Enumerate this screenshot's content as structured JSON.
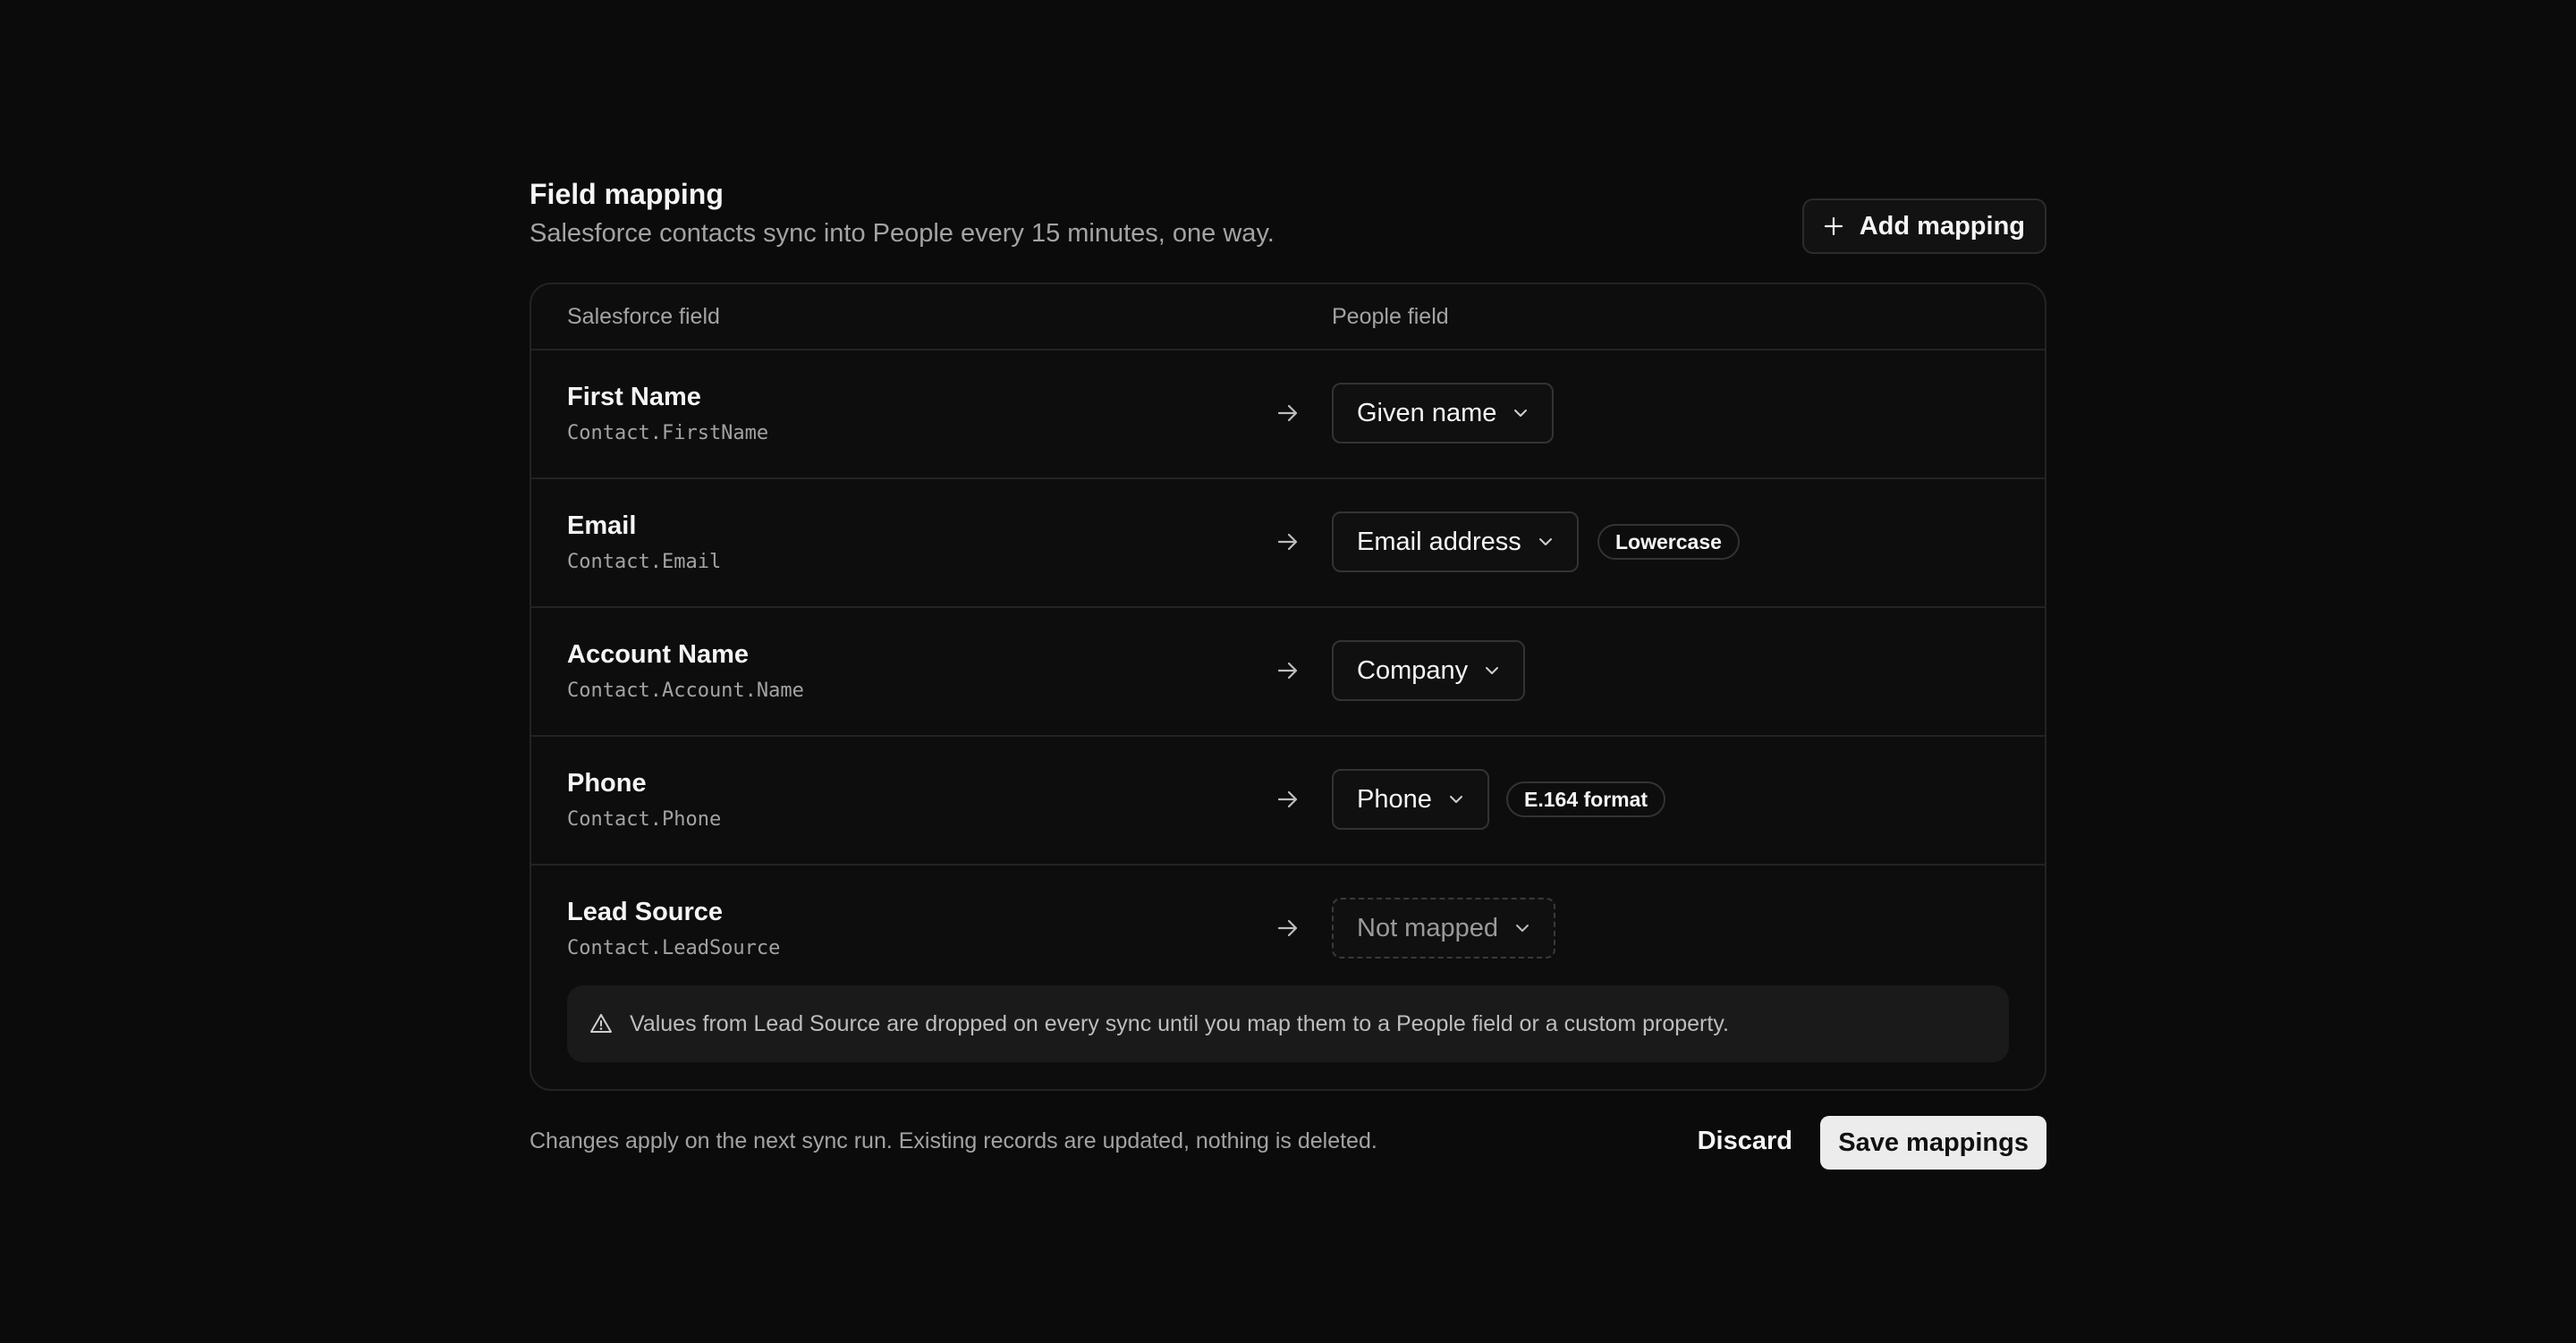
{
  "header": {
    "title": "Field mapping",
    "subtitle": "Salesforce contacts sync into People every 15 minutes, one way.",
    "add_button_label": "Add mapping"
  },
  "table": {
    "columns": [
      "Salesforce field",
      "People field"
    ],
    "rows": [
      {
        "name": "First Name",
        "path": "Contact.FirstName",
        "target": "Given name",
        "badge": ""
      },
      {
        "name": "Email",
        "path": "Contact.Email",
        "target": "Email address",
        "badge": "Lowercase"
      },
      {
        "name": "Account Name",
        "path": "Contact.Account.Name",
        "target": "Company",
        "badge": ""
      },
      {
        "name": "Phone",
        "path": "Contact.Phone",
        "target": "Phone",
        "badge": "E.164 format"
      },
      {
        "name": "Lead Source",
        "path": "Contact.LeadSource",
        "target": "Not mapped",
        "badge": ""
      }
    ],
    "warning": "Values from Lead Source are dropped on every sync until you map them to a People field or a custom property."
  },
  "footer": {
    "note": "Changes apply on the next sync run. Existing records are updated, nothing is deleted.",
    "discard_label": "Discard",
    "save_label": "Save mappings"
  },
  "icons": {
    "add": "plus-icon",
    "row_arrow": "arrow-right-icon",
    "select": "chevron-down-icon",
    "warning": "warning-triangle-icon"
  },
  "colors": {
    "background": "#0b0b0b",
    "primary_button": "#ececec",
    "muted_text": "#a3a3a3"
  }
}
